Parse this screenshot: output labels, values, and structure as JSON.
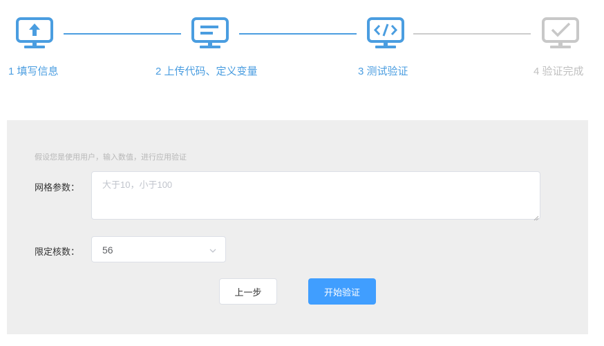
{
  "colors": {
    "active": "#4a9de0",
    "inactive": "#c0c0c0",
    "panel_bg": "#eeeeee",
    "primary_button": "#409eff"
  },
  "steps": [
    {
      "label": "1 填写信息",
      "state": "active",
      "icon": "upload-monitor-icon"
    },
    {
      "label": "2 上传代码、定义变量",
      "state": "active",
      "icon": "document-monitor-icon"
    },
    {
      "label": "3 测试验证",
      "state": "active",
      "icon": "code-monitor-icon"
    },
    {
      "label": "4 验证完成",
      "state": "inactive",
      "icon": "check-monitor-icon"
    }
  ],
  "form": {
    "hint": "假设您是使用用户，输入数值，进行应用验证",
    "grid_params": {
      "label": "网格参数：",
      "value": "",
      "placeholder": "大于10，小于100"
    },
    "core_count": {
      "label": "限定核数：",
      "value": "56"
    }
  },
  "buttons": {
    "prev": "上一步",
    "start": "开始验证"
  }
}
